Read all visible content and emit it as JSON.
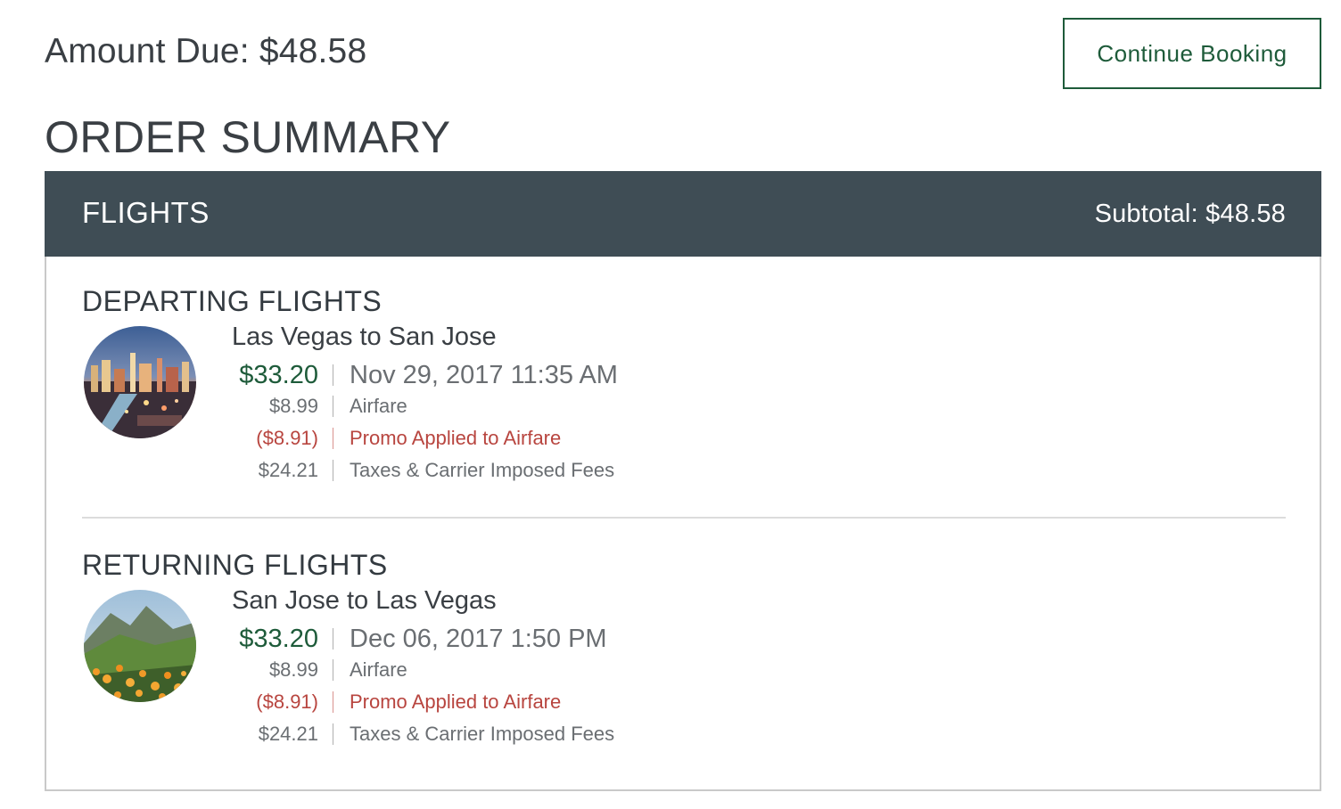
{
  "header": {
    "amount_due": "Amount Due: $48.58",
    "continue_label": "Continue Booking"
  },
  "summary": {
    "title": "ORDER SUMMARY"
  },
  "panel": {
    "title": "FLIGHTS",
    "subtotal": "Subtotal: $48.58"
  },
  "departing": {
    "title": "DEPARTING FLIGHTS",
    "route": "Las Vegas to San Jose",
    "thumbnail": "las-vegas-strip-photo",
    "total": "$33.20",
    "datetime": "Nov 29, 2017 11:35 AM",
    "airfare_amount": "$8.99",
    "airfare_label": "Airfare",
    "promo_amount": "($8.91)",
    "promo_label": "Promo Applied to Airfare",
    "taxes_amount": "$24.21",
    "taxes_label": "Taxes & Carrier Imposed Fees"
  },
  "returning": {
    "title": "RETURNING FLIGHTS",
    "route": "San Jose to Las Vegas",
    "thumbnail": "poppy-hillside-photo",
    "total": "$33.20",
    "datetime": "Dec 06, 2017 1:50 PM",
    "airfare_amount": "$8.99",
    "airfare_label": "Airfare",
    "promo_amount": "($8.91)",
    "promo_label": "Promo Applied to Airfare",
    "taxes_amount": "$24.21",
    "taxes_label": "Taxes & Carrier Imposed Fees"
  },
  "colors": {
    "brand_green": "#1e5b3a",
    "header_bg": "#3f4d55",
    "promo_red": "#b8453f"
  }
}
